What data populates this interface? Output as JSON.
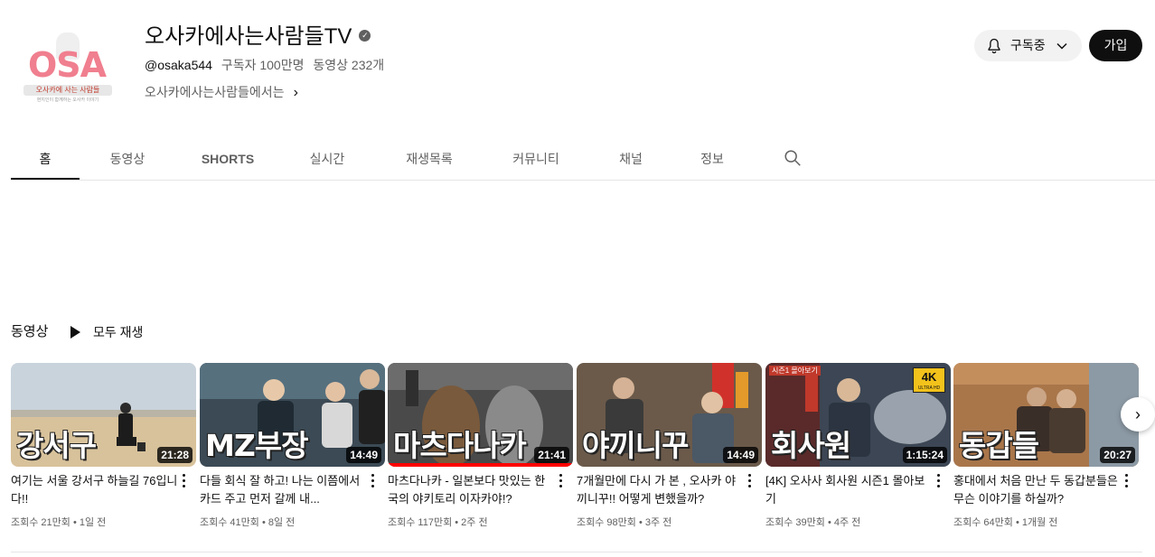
{
  "channel": {
    "logo_text": "OSA",
    "logo_bar": "오사카에 사는 사람들",
    "logo_sub": "현지인이 함께하는 오사카 이야기",
    "title": "오사카에사는사람들TV",
    "handle": "@osaka544",
    "subscribers": "구독자 100만명",
    "video_count": "동영상 232개",
    "about": "오사카에사는사람들에서는",
    "verified_glyph": "✓"
  },
  "actions": {
    "subscribe_label": "구독중",
    "join_label": "가입"
  },
  "tabs": [
    {
      "label": "홈"
    },
    {
      "label": "동영상"
    },
    {
      "label": "SHORTS"
    },
    {
      "label": "실시간"
    },
    {
      "label": "재생목록"
    },
    {
      "label": "커뮤니티"
    },
    {
      "label": "채널"
    },
    {
      "label": "정보"
    }
  ],
  "section": {
    "title": "동영상",
    "play_all": "모두 재생"
  },
  "videos": [
    {
      "overlay": "강서구",
      "duration": "21:28",
      "title": "여기는 서울 강서구 하늘길 76입니다!!",
      "views": "조회수 21만회",
      "age": "1일 전"
    },
    {
      "overlay": "MZ부장",
      "duration": "14:49",
      "title": "다들 회식 잘 하고! 나는 이쯤에서 카드 주고 먼저 갈께 내...",
      "views": "조회수 41만회",
      "age": "8일 전"
    },
    {
      "overlay": "마츠다나카",
      "duration": "21:41",
      "title": "마츠다나카 - 일본보다 맛있는 한국의 야키토리 이자카야!?",
      "views": "조회수 117만회",
      "age": "2주 전"
    },
    {
      "overlay": "야끼니꾸",
      "duration": "14:49",
      "title": "7개월만에 다시 가 본 , 오사카 야끼니꾸!! 어떻게 변했을까?",
      "views": "조회수 98만회",
      "age": "3주 전"
    },
    {
      "overlay": "회사원",
      "duration": "1:15:24",
      "title": "[4K] 오사사 회사원 시즌1 몰아보기",
      "views": "조회수 39만회",
      "age": "4주 전",
      "badge": "4K",
      "badge_sub": "ULTRA HD",
      "tag": "시즌1 몰아보기"
    },
    {
      "overlay": "동갑들",
      "duration": "20:27",
      "title": "홍대에서 처음 만난 두 동갑분들은 무슨 이야기를 하실까?",
      "views": "조회수 64만회",
      "age": "1개월 전"
    }
  ],
  "colors": {
    "logo_pink": "#f07f8f",
    "progress_red": "#ff0000",
    "text_secondary": "#606060"
  }
}
